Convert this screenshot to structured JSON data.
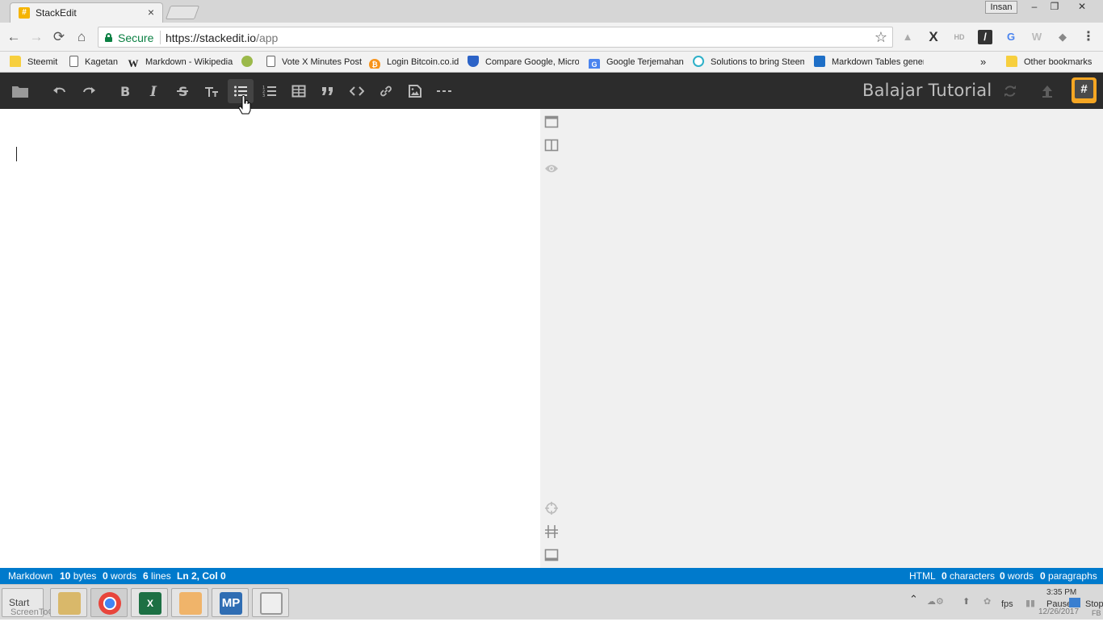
{
  "browser": {
    "tab": {
      "favicon": "#",
      "title": "StackEdit"
    },
    "profile": "Insan",
    "window_controls": {
      "minimize": "–",
      "restore": "❐",
      "close": "✕"
    },
    "nav": {
      "back": "←",
      "forward": "→",
      "reload": "⟳",
      "home": "⌂"
    },
    "address": {
      "secure_label": "Secure",
      "url_host": "https://stackedit.io",
      "url_path": "/app",
      "star": "☆"
    },
    "extensions": [
      "drive-icon",
      "x-icon",
      "hd-icon",
      "feather-icon",
      "translate-icon",
      "wordpress-icon",
      "puzzle-icon",
      "menu-icon"
    ],
    "bookmarks": [
      {
        "icon": "folder",
        "label": "Steemit"
      },
      {
        "icon": "page",
        "label": "Kagetan"
      },
      {
        "icon": "wikipedia",
        "label": "Markdown - Wikipedia"
      },
      {
        "icon": "green-circle",
        "label": ""
      },
      {
        "icon": "page",
        "label": "Vote X Minutes Post"
      },
      {
        "icon": "bitcoin",
        "label": "Login Bitcoin.co.id"
      },
      {
        "icon": "shield",
        "label": "Compare Google, Micro"
      },
      {
        "icon": "google-translate",
        "label": "Google Terjemahan"
      },
      {
        "icon": "teal-circle",
        "label": "Solutions to bring Steem"
      },
      {
        "icon": "table",
        "label": "Markdown Tables gener"
      }
    ],
    "bookmarks_overflow": "»",
    "other_bookmarks": "Other bookmarks"
  },
  "stackedit": {
    "title": "Balajar Tutorial",
    "logo": "#",
    "toolbar": [
      "folder",
      "undo",
      "redo",
      "bold",
      "italic",
      "strikethrough",
      "heading",
      "bulleted-list",
      "numbered-list",
      "table",
      "quote",
      "code",
      "link",
      "image",
      "horizontal-rule"
    ],
    "active_tool": "bulleted-list"
  },
  "status": {
    "left": {
      "mode": "Markdown",
      "bytes_n": "10",
      "bytes": "bytes",
      "words_n": "0",
      "words": "words",
      "lines_n": "6",
      "lines": "lines",
      "position": "Ln 2, Col 0"
    },
    "right": {
      "mode": "HTML",
      "chars_n": "0",
      "chars": "characters",
      "words_n": "0",
      "words": "words",
      "paras_n": "0",
      "paras": "paragraphs"
    }
  },
  "taskbar": {
    "start": "Start",
    "watermark": "ScreenToGif",
    "apps": [
      "file-manager",
      "chrome",
      "excel",
      "outlook",
      "mp",
      "monitor"
    ],
    "mp_label": "MP",
    "tray": {
      "chevron": "⌃",
      "fps": "fps",
      "pause": "Pause",
      "stop": "Stop",
      "time": "3:35 PM",
      "date": "12/26/2017",
      "lang": "FB"
    }
  },
  "colors": {
    "statusbar": "#007acc",
    "navbar": "#2c2c2c",
    "preview_bg": "#f0f0f0",
    "logo": "#f5a623"
  }
}
